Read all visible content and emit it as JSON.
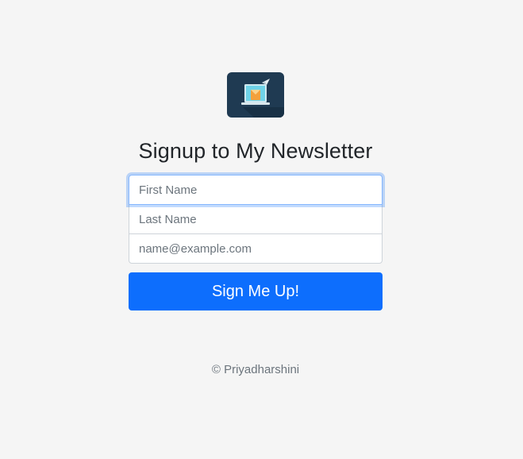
{
  "logo": {
    "icon": "newsletter-mail-icon",
    "colors": {
      "background": "#1f3a52",
      "screen": "#6fd3e8",
      "envelope": "#f4a13c"
    }
  },
  "heading": "Signup to My Newsletter",
  "form": {
    "first_name_placeholder": "First Name",
    "last_name_placeholder": "Last Name",
    "email_placeholder": "name@example.com",
    "submit_label": "Sign Me Up!"
  },
  "footer": {
    "text": "© Priyadharshini"
  },
  "colors": {
    "page_background": "#f5f5f5",
    "primary": "#0d6efd",
    "focus_ring": "#86b7fe"
  }
}
